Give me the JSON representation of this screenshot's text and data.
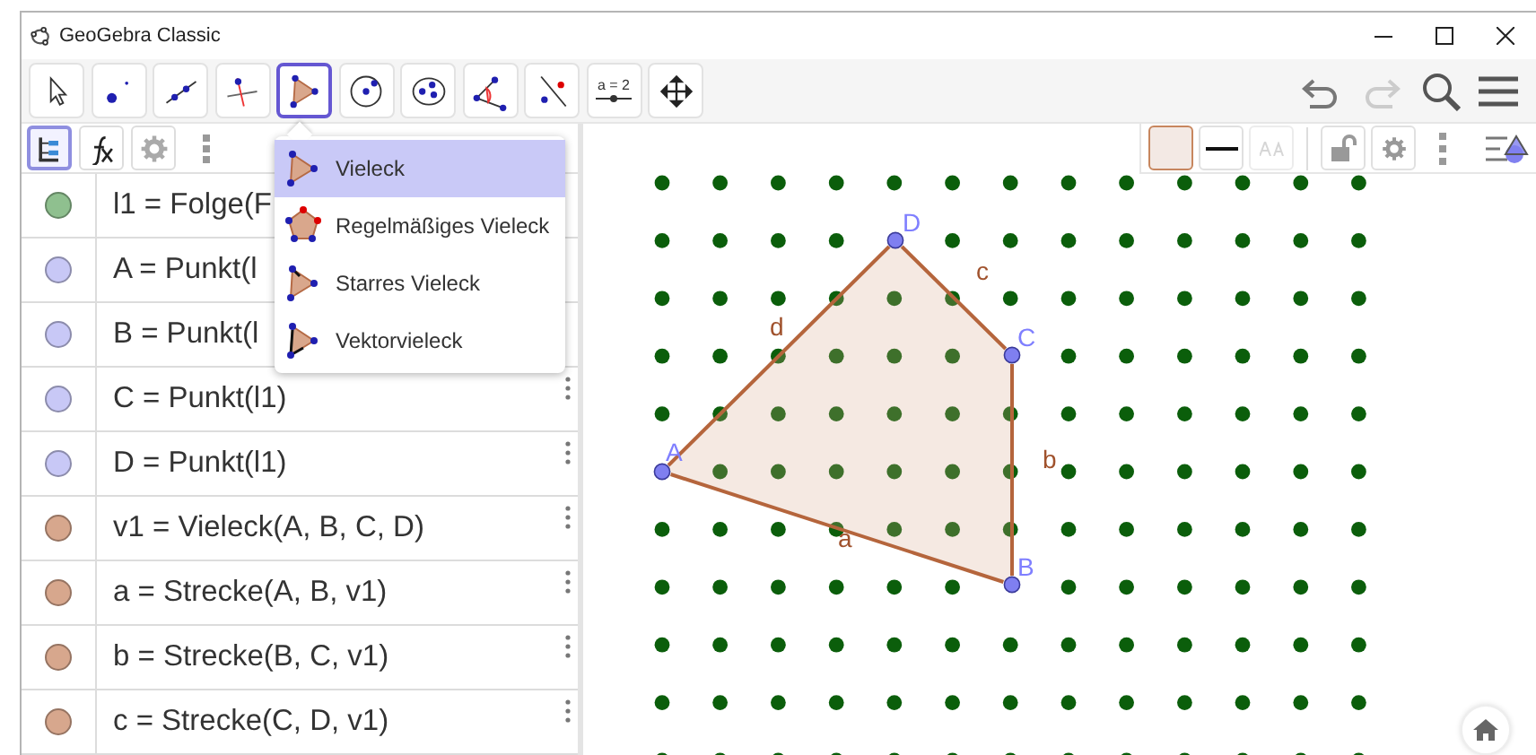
{
  "window": {
    "title": "GeoGebra Classic"
  },
  "toolbar": {
    "tools": [
      {
        "kind": "move",
        "selected": false
      },
      {
        "kind": "point",
        "selected": false
      },
      {
        "kind": "line",
        "selected": false
      },
      {
        "kind": "perpendicular",
        "selected": false
      },
      {
        "kind": "polygon",
        "selected": true
      },
      {
        "kind": "circle",
        "selected": false
      },
      {
        "kind": "conic",
        "selected": false
      },
      {
        "kind": "angle",
        "selected": false
      },
      {
        "kind": "reflect",
        "selected": false
      },
      {
        "kind": "slider",
        "selected": false,
        "label": "a = 2"
      },
      {
        "kind": "pan",
        "selected": false
      }
    ]
  },
  "tool_menu": {
    "items": [
      {
        "kind": "polygon",
        "label": "Vieleck",
        "selected": true
      },
      {
        "kind": "regular",
        "label": "Regelmäßiges Vieleck",
        "selected": false
      },
      {
        "kind": "rigid",
        "label": "Starres Vieleck",
        "selected": false
      },
      {
        "kind": "vector",
        "label": "Vektorvieleck",
        "selected": false
      }
    ]
  },
  "algebra": {
    "header": [
      {
        "kind": "tree",
        "selected": true
      },
      {
        "kind": "fx",
        "selected": false
      },
      {
        "kind": "gear",
        "selected": false
      }
    ],
    "rows": [
      {
        "formula": "l1 = Folge(F",
        "color": "#8fc08f",
        "menu": false
      },
      {
        "formula": "A = Punkt(l",
        "color": "#c8c8f6",
        "menu": false
      },
      {
        "formula": "B = Punkt(l",
        "color": "#c8c8f6",
        "menu": false
      },
      {
        "formula": "C = Punkt(l1)",
        "color": "#c8c8f6",
        "menu": true
      },
      {
        "formula": "D = Punkt(l1)",
        "color": "#c8c8f6",
        "menu": true
      },
      {
        "formula": "v1 = Vieleck(A, B, C, D)",
        "color": "#d7a78d",
        "menu": true
      },
      {
        "formula": "a = Strecke(A, B, v1)",
        "color": "#d7a78d",
        "menu": true
      },
      {
        "formula": "b = Strecke(B, C, v1)",
        "color": "#d7a78d",
        "menu": true
      },
      {
        "formula": "c = Strecke(C, D, v1)",
        "color": "#d7a78d",
        "menu": true
      }
    ]
  },
  "graphics": {
    "points": [
      {
        "label": "A"
      },
      {
        "label": "B"
      },
      {
        "label": "C"
      },
      {
        "label": "D"
      }
    ],
    "segments": [
      {
        "label": "a"
      },
      {
        "label": "b"
      },
      {
        "label": "c"
      },
      {
        "label": "d"
      }
    ],
    "style_bar": [
      {
        "kind": "color"
      },
      {
        "kind": "line"
      },
      {
        "kind": "text",
        "disabled": true
      },
      {
        "kind": "lock"
      },
      {
        "kind": "gear"
      },
      {
        "kind": "kebab"
      },
      {
        "kind": "toggle"
      }
    ]
  }
}
